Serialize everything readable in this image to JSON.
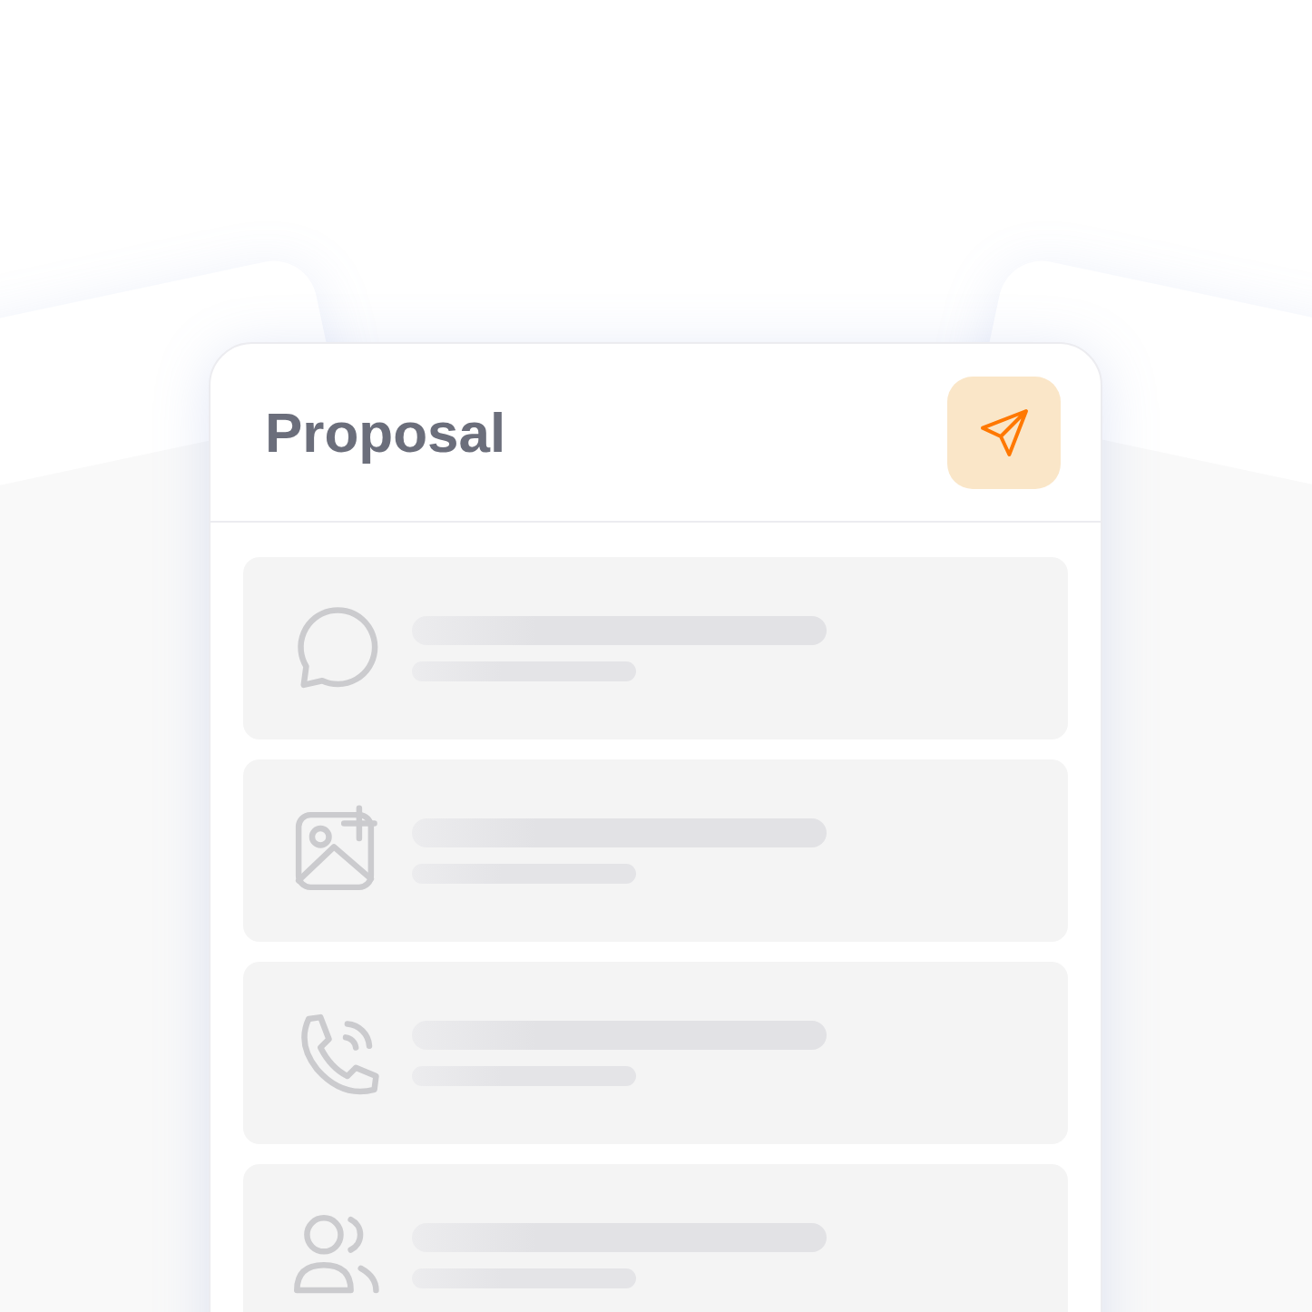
{
  "card": {
    "title": "Proposal",
    "send_button": {
      "kind": "send"
    }
  },
  "rows": [
    {
      "kind": "chat"
    },
    {
      "kind": "image-add"
    },
    {
      "kind": "phone"
    },
    {
      "kind": "users"
    }
  ]
}
